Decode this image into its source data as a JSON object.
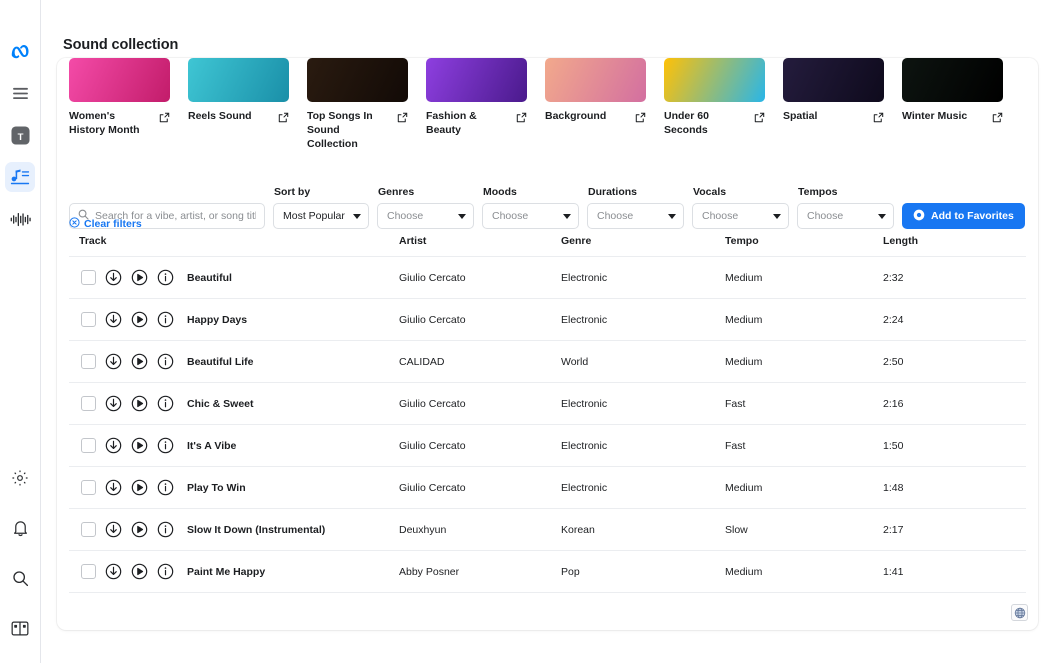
{
  "header": {
    "title": "Sound collection"
  },
  "sidebar": {
    "top_items": [
      {
        "name": "meta-logo",
        "label": "Meta"
      },
      {
        "name": "menu",
        "label": "Menu"
      },
      {
        "name": "text-tool",
        "label": "T"
      },
      {
        "name": "sound-collection",
        "label": "Sound collection",
        "active": true
      },
      {
        "name": "audio-waveform",
        "label": "Audio"
      }
    ],
    "bottom_items": [
      {
        "name": "settings",
        "label": "Settings"
      },
      {
        "name": "notifications",
        "label": "Notifications"
      },
      {
        "name": "search",
        "label": "Search"
      },
      {
        "name": "library",
        "label": "Library"
      }
    ]
  },
  "collections": [
    {
      "label": "Women's History Month",
      "color_a": "#f44ba8",
      "color_b": "#c21c6a"
    },
    {
      "label": "Reels Sound",
      "color_a": "#3fc6d4",
      "color_b": "#1a8fa8"
    },
    {
      "label": "Top Songs In Sound Collection",
      "color_a": "#2a1b10",
      "color_b": "#120a06"
    },
    {
      "label": "Fashion & Beauty",
      "color_a": "#8e3fe0",
      "color_b": "#4a1a8c"
    },
    {
      "label": "Background",
      "color_a": "#f2a98c",
      "color_b": "#d36fa0"
    },
    {
      "label": "Under 60 Seconds",
      "color_a": "#ffc107",
      "color_b": "#29b6e8"
    },
    {
      "label": "Spatial",
      "color_a": "#241c3d",
      "color_b": "#0e0a1c"
    },
    {
      "label": "Winter Music",
      "color_a": "#0d1410",
      "color_b": "#000000"
    }
  ],
  "filters": {
    "search": {
      "placeholder": "Search for a vibe, artist, or song title",
      "value": ""
    },
    "sort_by": {
      "label": "Sort by",
      "value": "Most Popular"
    },
    "genres": {
      "label": "Genres",
      "value": "Choose"
    },
    "moods": {
      "label": "Moods",
      "value": "Choose"
    },
    "durations": {
      "label": "Durations",
      "value": "Choose"
    },
    "vocals": {
      "label": "Vocals",
      "value": "Choose"
    },
    "tempos": {
      "label": "Tempos",
      "value": "Choose"
    },
    "add_to_favorites": "Add to Favorites",
    "clear_filters": "Clear filters"
  },
  "table": {
    "columns": [
      "Track",
      "Artist",
      "Genre",
      "Tempo",
      "Length"
    ],
    "rows": [
      {
        "track": "Beautiful",
        "artist": "Giulio Cercato",
        "genre": "Electronic",
        "tempo": "Medium",
        "length": "2:32"
      },
      {
        "track": "Happy Days",
        "artist": "Giulio Cercato",
        "genre": "Electronic",
        "tempo": "Medium",
        "length": "2:24"
      },
      {
        "track": "Beautiful Life",
        "artist": "CALIDAD",
        "genre": "World",
        "tempo": "Medium",
        "length": "2:50"
      },
      {
        "track": "Chic & Sweet",
        "artist": "Giulio Cercato",
        "genre": "Electronic",
        "tempo": "Fast",
        "length": "2:16"
      },
      {
        "track": "It's A Vibe",
        "artist": "Giulio Cercato",
        "genre": "Electronic",
        "tempo": "Fast",
        "length": "1:50"
      },
      {
        "track": "Play To Win",
        "artist": "Giulio Cercato",
        "genre": "Electronic",
        "tempo": "Medium",
        "length": "1:48"
      },
      {
        "track": "Slow It Down (Instrumental)",
        "artist": "Deuxhyun",
        "genre": "Korean",
        "tempo": "Slow",
        "length": "2:17"
      },
      {
        "track": "Paint Me Happy",
        "artist": "Abby Posner",
        "genre": "Pop",
        "tempo": "Medium",
        "length": "1:41"
      }
    ],
    "row_icons": [
      "download-icon",
      "play-icon",
      "info-icon"
    ]
  },
  "colors": {
    "accent": "#1877f2",
    "active_bg": "#e7f0fd",
    "text": "#1c1e21",
    "muted": "#65676b"
  }
}
